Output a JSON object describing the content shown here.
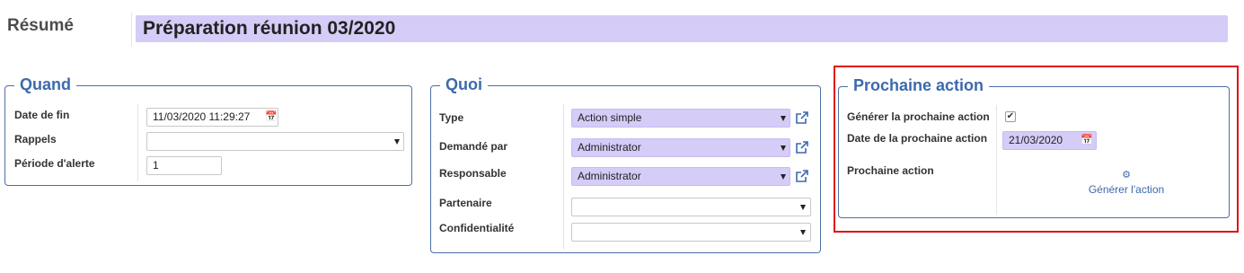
{
  "header": {
    "resume_label": "Résumé",
    "title": "Préparation réunion 03/2020"
  },
  "quand": {
    "legend": "Quand",
    "date_fin_label": "Date de fin",
    "date_fin_value": "11/03/2020 11:29:27",
    "rappels_label": "Rappels",
    "rappels_value": "",
    "periode_label": "Période d'alerte",
    "periode_value": "1"
  },
  "quoi": {
    "legend": "Quoi",
    "type_label": "Type",
    "type_value": "Action simple",
    "demande_label": "Demandé par",
    "demande_value": "Administrator",
    "responsable_label": "Responsable",
    "responsable_value": "Administrator",
    "partenaire_label": "Partenaire",
    "partenaire_value": "",
    "confid_label": "Confidentialité",
    "confid_value": ""
  },
  "prochaine": {
    "legend": "Prochaine action",
    "generer_label": "Générer la prochaine action",
    "generer_checked": true,
    "date_label": "Date de la prochaine action",
    "date_value": "21/03/2020",
    "action_label": "Prochaine action",
    "generer_button": "Générer l'action"
  },
  "colors": {
    "accent": "#3d69ad",
    "required_bg": "#d5ccf7",
    "highlight": "#e10f0f"
  }
}
